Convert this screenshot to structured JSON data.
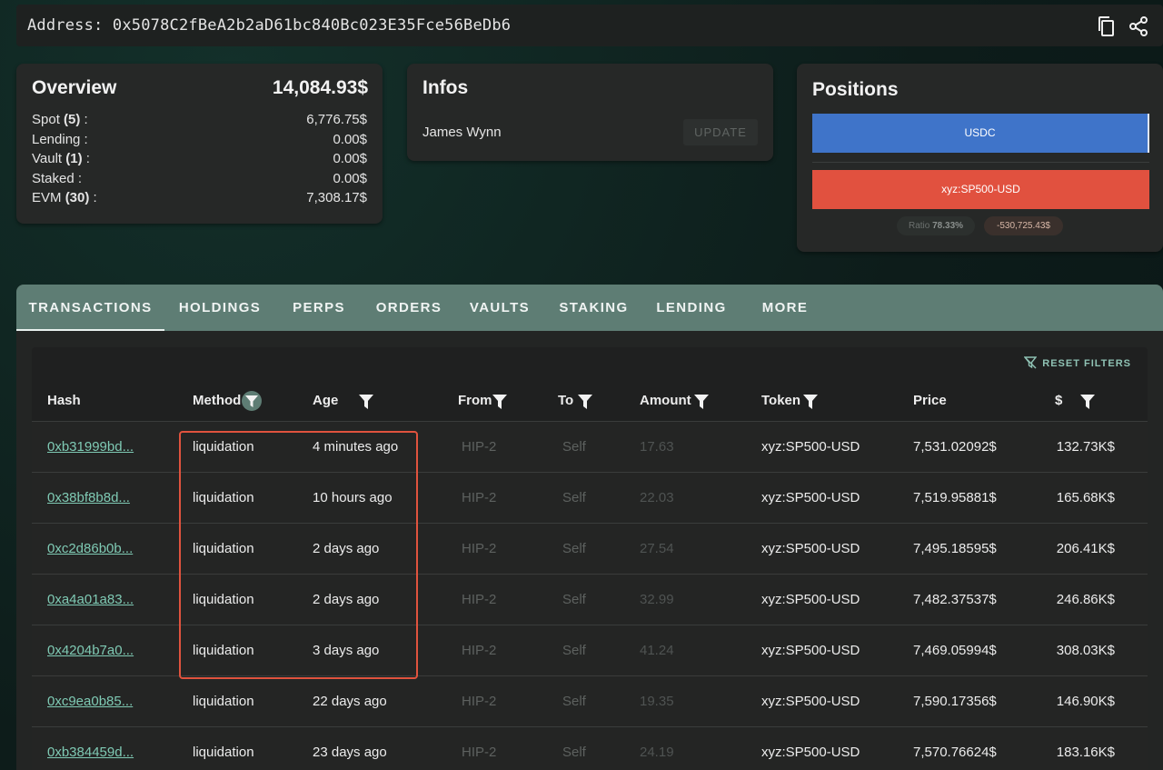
{
  "address": {
    "label": "Address:",
    "value": "0x5078C2fBeA2b2aD61bc840Bc023E35Fce56BeDb6",
    "copy_icon": "copy-icon",
    "share_icon": "share-icon"
  },
  "overview": {
    "title": "Overview",
    "total": "14,084.93$",
    "rows": [
      {
        "label": "Spot",
        "count": "(5)",
        "suffix": " :",
        "value": "6,776.75$"
      },
      {
        "label": "Lending :",
        "count": "",
        "suffix": "",
        "value": "0.00$"
      },
      {
        "label": "Vault",
        "count": "(1)",
        "suffix": " :",
        "value": "0.00$"
      },
      {
        "label": "Staked :",
        "count": "",
        "suffix": "",
        "value": "0.00$"
      },
      {
        "label": "EVM",
        "count": "(30)",
        "suffix": " :",
        "value": "7,308.17$"
      }
    ]
  },
  "infos": {
    "title": "Infos",
    "name": "James Wynn",
    "update_label": "UPDATE"
  },
  "positions": {
    "title": "Positions",
    "bars": [
      {
        "label": "USDC",
        "color": "#3f74c9"
      },
      {
        "label": "xyz:SP500-USD",
        "color": "#e1513f"
      }
    ],
    "ratio_label": "Ratio",
    "ratio_value": "78.33%",
    "net": "-530,725.43$"
  },
  "tabs": [
    "TRANSACTIONS",
    "HOLDINGS",
    "PERPS",
    "ORDERS",
    "VAULTS",
    "STAKING",
    "LENDING",
    "MORE"
  ],
  "active_tab": "TRANSACTIONS",
  "table": {
    "reset_filters": "RESET FILTERS",
    "columns": [
      "Hash",
      "Method",
      "Age",
      "From",
      "To",
      "Amount",
      "Token",
      "Price",
      "$"
    ],
    "rows": [
      {
        "hash": "0xb31999bd...",
        "method": "liquidation",
        "age": "4 minutes ago",
        "from": "HIP-2",
        "to": "Self",
        "amount": "17.63",
        "token": "xyz:SP500-USD",
        "price": "7,531.02092$",
        "usd": "132.73K$"
      },
      {
        "hash": "0x38bf8b8d...",
        "method": "liquidation",
        "age": "10 hours ago",
        "from": "HIP-2",
        "to": "Self",
        "amount": "22.03",
        "token": "xyz:SP500-USD",
        "price": "7,519.95881$",
        "usd": "165.68K$"
      },
      {
        "hash": "0xc2d86b0b...",
        "method": "liquidation",
        "age": "2 days ago",
        "from": "HIP-2",
        "to": "Self",
        "amount": "27.54",
        "token": "xyz:SP500-USD",
        "price": "7,495.18595$",
        "usd": "206.41K$"
      },
      {
        "hash": "0xa4a01a83...",
        "method": "liquidation",
        "age": "2 days ago",
        "from": "HIP-2",
        "to": "Self",
        "amount": "32.99",
        "token": "xyz:SP500-USD",
        "price": "7,482.37537$",
        "usd": "246.86K$"
      },
      {
        "hash": "0x4204b7a0...",
        "method": "liquidation",
        "age": "3 days ago",
        "from": "HIP-2",
        "to": "Self",
        "amount": "41.24",
        "token": "xyz:SP500-USD",
        "price": "7,469.05994$",
        "usd": "308.03K$"
      },
      {
        "hash": "0xc9ea0b85...",
        "method": "liquidation",
        "age": "22 days ago",
        "from": "HIP-2",
        "to": "Self",
        "amount": "19.35",
        "token": "xyz:SP500-USD",
        "price": "7,590.17356$",
        "usd": "146.90K$"
      },
      {
        "hash": "0xb384459d...",
        "method": "liquidation",
        "age": "23 days ago",
        "from": "HIP-2",
        "to": "Self",
        "amount": "24.19",
        "token": "xyz:SP500-USD",
        "price": "7,570.76624$",
        "usd": "183.16K$"
      }
    ]
  },
  "colors": {
    "accent": "#5e7d74",
    "link": "#7fcab4",
    "highlight": "#e0533e"
  }
}
